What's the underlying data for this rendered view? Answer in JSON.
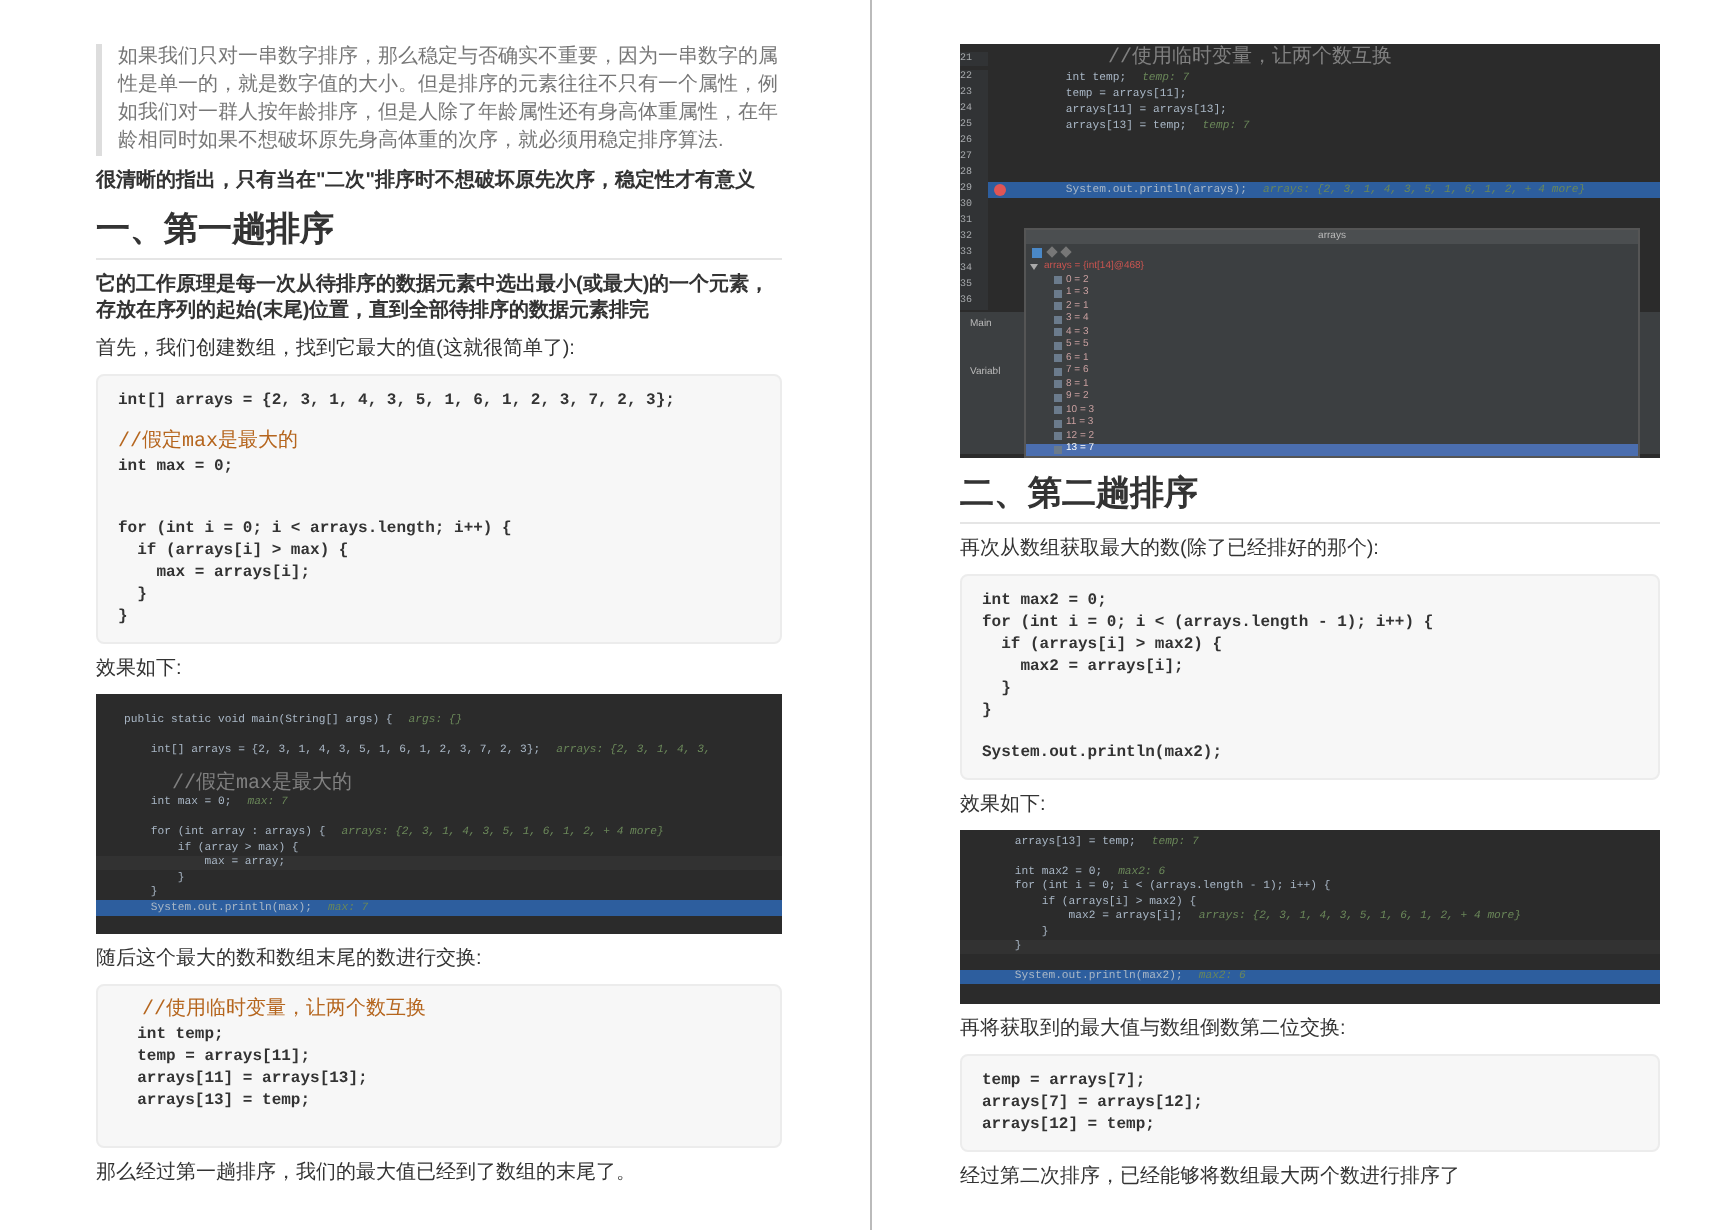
{
  "pages": [
    {
      "blocks": [
        {
          "kind": "quote",
          "text": "如果我们只对一串数字排序，那么稳定与否确实不重要，因为一串数字的属性是单一的，就是数字值的大小。但是排序的元素往往不只有一个属性，例如我们对一群人按年龄排序，但是人除了年龄属性还有身高体重属性，在年龄相同时如果不想破坏原先身高体重的次序，就必须用稳定排序算法."
        },
        {
          "kind": "para",
          "bold": true,
          "text": "很清晰的指出，只有当在\"二次\"排序时不想破坏原先次序，稳定性才有意义"
        },
        {
          "kind": "heading",
          "text": "一、第一趟排序"
        },
        {
          "kind": "para",
          "bold": true,
          "text": "它的工作原理是每一次从待排序的数据元素中选出最小(或最大)的一个元素，存放在序列的起始(末尾)位置，直到全部待排序的数据元素排完"
        },
        {
          "kind": "para",
          "bold": false,
          "text": "首先，我们创建数组，找到它最大的值(这就很简单了):"
        },
        {
          "kind": "code",
          "lines": [
            {
              "kind": "code",
              "text": "int[] arrays = {2, 3, 1, 4, 3, 5, 1, 6, 1, 2, 3, 7, 2, 3};"
            },
            {
              "kind": "blank"
            },
            {
              "kind": "comment",
              "text": "//假定max是最大的"
            },
            {
              "kind": "code",
              "text": "int max = 0;"
            },
            {
              "kind": "blank"
            },
            {
              "kind": "blank"
            },
            {
              "kind": "code",
              "text": "for (int i = 0; i < arrays.length; i++) {"
            },
            {
              "kind": "code",
              "text": "  if (arrays[i] > max) {"
            },
            {
              "kind": "code",
              "text": "    max = arrays[i];"
            },
            {
              "kind": "code",
              "text": "  }"
            },
            {
              "kind": "code",
              "text": "}"
            }
          ]
        },
        {
          "kind": "para",
          "bold": false,
          "text": "效果如下:"
        },
        {
          "kind": "ide",
          "lines": [
            {
              "kind": "blank"
            },
            {
              "kind": "code",
              "text": "public static void main(String[] args) {",
              "hint": "args: {}"
            },
            {
              "kind": "blank"
            },
            {
              "kind": "code",
              "text": "    int[] arrays = {2, 3, 1, 4, 3, 5, 1, 6, 1, 2, 3, 7, 2, 3};",
              "hint": "arrays: {2, 3, 1, 4, 3,"
            },
            {
              "kind": "blank"
            },
            {
              "kind": "comment",
              "text": "    //假定max是最大的"
            },
            {
              "kind": "code",
              "text": "    int max = 0;",
              "hint": "max: 7"
            },
            {
              "kind": "blank"
            },
            {
              "kind": "code",
              "text": "    for (int array : arrays) {",
              "hint": "arrays: {2, 3, 1, 4, 3, 5, 1, 6, 1, 2, + 4 more}"
            },
            {
              "kind": "code",
              "text": "        if (array > max) {"
            },
            {
              "kind": "current",
              "text": "            max = array;"
            },
            {
              "kind": "code",
              "text": "        }"
            },
            {
              "kind": "code",
              "text": "    }"
            },
            {
              "kind": "highlight",
              "text": "    System.out.println(max);",
              "hint": "max: 7"
            },
            {
              "kind": "blank"
            }
          ]
        },
        {
          "kind": "para",
          "bold": false,
          "text": "随后这个最大的数和数组末尾的数进行交换:"
        },
        {
          "kind": "code",
          "lines": [
            {
              "kind": "comment",
              "text": "  //使用临时变量，让两个数互换"
            },
            {
              "kind": "code",
              "text": "  int temp;"
            },
            {
              "kind": "code",
              "text": "  temp = arrays[11];"
            },
            {
              "kind": "code",
              "text": "  arrays[11] = arrays[13];"
            },
            {
              "kind": "code",
              "text": "  arrays[13] = temp;"
            },
            {
              "kind": "blank"
            }
          ]
        },
        {
          "kind": "para",
          "bold": false,
          "text": "那么经过第一趟排序，我们的最大值已经到了数组的末尾了。"
        }
      ]
    },
    {
      "blocks": [
        {
          "kind": "ide",
          "lines": [
            {
              "kind": "comment",
              "number": "21",
              "text": "        //使用临时变量，让两个数互换"
            },
            {
              "kind": "code",
              "number": "22",
              "text": "        int temp;",
              "hint": "temp: 7"
            },
            {
              "kind": "code",
              "number": "23",
              "text": "        temp = arrays[11];"
            },
            {
              "kind": "code",
              "number": "24",
              "text": "        arrays[11] = arrays[13];"
            },
            {
              "kind": "code",
              "number": "25",
              "text": "        arrays[13] = temp;",
              "hint": "temp: 7"
            },
            {
              "kind": "blank",
              "number": "26"
            },
            {
              "kind": "blank",
              "number": "27"
            },
            {
              "kind": "blank",
              "number": "28"
            },
            {
              "kind": "highlight",
              "number": "29",
              "breakpoint": true,
              "text": "        System.out.println(arrays);",
              "hint": "arrays: {2, 3, 1, 4, 3, 5, 1, 6, 1, 2, + 4 more}"
            },
            {
              "kind": "blank",
              "number": "30"
            },
            {
              "kind": "blank",
              "number": "31"
            },
            {
              "kind": "blank",
              "number": "32"
            },
            {
              "kind": "blank",
              "number": "33"
            },
            {
              "kind": "blank",
              "number": "34"
            },
            {
              "kind": "blank",
              "number": "35"
            },
            {
              "kind": "blank",
              "number": "36"
            }
          ],
          "panel": {
            "tabs": [
              "Main",
              "Variabl"
            ]
          },
          "popup": {
            "title": "arrays",
            "root": "arrays = {int[14]@468}",
            "items": [
              {
                "text": "0 = 2",
                "selected": false
              },
              {
                "text": "1 = 3",
                "selected": false
              },
              {
                "text": "2 = 1",
                "selected": false
              },
              {
                "text": "3 = 4",
                "selected": false
              },
              {
                "text": "4 = 3",
                "selected": false
              },
              {
                "text": "5 = 5",
                "selected": false
              },
              {
                "text": "6 = 1",
                "selected": false
              },
              {
                "text": "7 = 6",
                "selected": false
              },
              {
                "text": "8 = 1",
                "selected": false
              },
              {
                "text": "9 = 2",
                "selected": false
              },
              {
                "text": "10 = 3",
                "selected": false
              },
              {
                "text": "11 = 3",
                "selected": false
              },
              {
                "text": "12 = 2",
                "selected": false
              },
              {
                "text": "13 = 7",
                "selected": true
              }
            ]
          }
        },
        {
          "kind": "heading",
          "text": "二、第二趟排序"
        },
        {
          "kind": "para",
          "bold": false,
          "text": "再次从数组获取最大的数(除了已经排好的那个):"
        },
        {
          "kind": "code",
          "lines": [
            {
              "kind": "code",
              "text": "int max2 = 0;"
            },
            {
              "kind": "code",
              "text": "for (int i = 0; i < (arrays.length - 1); i++) {"
            },
            {
              "kind": "code",
              "text": "  if (arrays[i] > max2) {"
            },
            {
              "kind": "code",
              "text": "    max2 = arrays[i];"
            },
            {
              "kind": "code",
              "text": "  }"
            },
            {
              "kind": "code",
              "text": "}"
            },
            {
              "kind": "blank"
            },
            {
              "kind": "code",
              "text": "System.out.println(max2);"
            }
          ]
        },
        {
          "kind": "para",
          "bold": false,
          "text": "效果如下:"
        },
        {
          "kind": "ide",
          "lines": [
            {
              "kind": "code",
              "text": "    arrays[13] = temp;",
              "hint": "temp: 7"
            },
            {
              "kind": "blank"
            },
            {
              "kind": "code",
              "text": "    int max2 = 0;",
              "hint": "max2: 6"
            },
            {
              "kind": "code",
              "text": "    for (int i = 0; i < (arrays.length - 1); i++) {"
            },
            {
              "kind": "code",
              "text": "        if (arrays[i] > max2) {"
            },
            {
              "kind": "code",
              "text": "            max2 = arrays[i];",
              "hint": "arrays: {2, 3, 1, 4, 3, 5, 1, 6, 1, 2, + 4 more}"
            },
            {
              "kind": "code",
              "text": "        }"
            },
            {
              "kind": "current",
              "text": "    }"
            },
            {
              "kind": "blank"
            },
            {
              "kind": "highlight",
              "text": "    System.out.println(max2);",
              "hint": "max2: 6"
            },
            {
              "kind": "blank"
            }
          ]
        },
        {
          "kind": "para",
          "bold": false,
          "text": "再将获取到的最大值与数组倒数第二位交换:"
        },
        {
          "kind": "code",
          "lines": [
            {
              "kind": "code",
              "text": "temp = arrays[7];"
            },
            {
              "kind": "code",
              "text": "arrays[7] = arrays[12];"
            },
            {
              "kind": "code",
              "text": "arrays[12] = temp;"
            }
          ]
        },
        {
          "kind": "para",
          "bold": false,
          "text": "经过第二次排序，已经能够将数组最大两个数进行排序了"
        }
      ]
    }
  ]
}
